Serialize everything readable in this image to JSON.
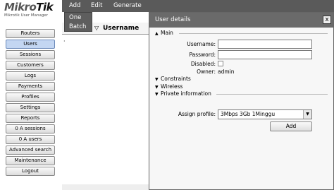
{
  "app": {
    "brand": "MikroTik",
    "brand_light": "Mikro",
    "brand_bold": "Tik",
    "subtitle": "Mikrotik User Manager"
  },
  "sidebar": {
    "items": [
      {
        "label": "Routers"
      },
      {
        "label": "Users",
        "active": true
      },
      {
        "label": "Sessions"
      },
      {
        "label": "Customers"
      },
      {
        "label": "Logs"
      },
      {
        "label": "Payments"
      },
      {
        "label": "Profiles"
      },
      {
        "label": "Settings"
      },
      {
        "label": "Reports"
      },
      {
        "label": "0 A sessions"
      },
      {
        "label": "0 A users"
      },
      {
        "label": "Advanced search"
      },
      {
        "label": "Maintenance"
      },
      {
        "label": "Logout"
      }
    ]
  },
  "menubar": {
    "add": "Add",
    "edit": "Edit",
    "generate": "Generate"
  },
  "add_menu": {
    "items": [
      "One",
      "Batch"
    ]
  },
  "grid": {
    "column": "Username",
    "row_marker": "·"
  },
  "dialog": {
    "title": "User details",
    "close": "x",
    "sections": {
      "main": "Main",
      "constraints": "Constraints",
      "wireless": "Wireless",
      "private": "Private information"
    },
    "fields": {
      "username_label": "Username:",
      "username_value": "",
      "password_label": "Password:",
      "password_value": "",
      "disabled_label": "Disabled:",
      "disabled_checked": false,
      "owner_label": "Owner:",
      "owner_value": "admin",
      "profile_label": "Assign profile:",
      "profile_value": "3Mbps 3Gb 1Minggu"
    },
    "add_button": "Add"
  },
  "colors": {
    "menubar": "#5a5a5a",
    "dialog_title": "#6a6a6a",
    "active_nav": "#c3d6f2"
  }
}
